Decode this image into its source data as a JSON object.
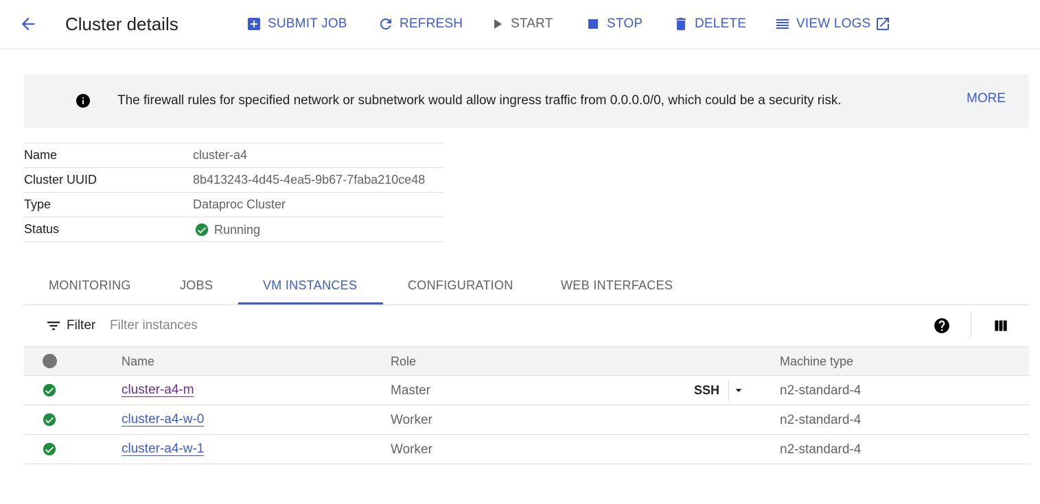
{
  "header": {
    "title": "Cluster details",
    "toolbar": {
      "submit_job": "SUBMIT JOB",
      "refresh": "REFRESH",
      "start": "START",
      "stop": "STOP",
      "delete": "DELETE",
      "view_logs": "VIEW LOGS"
    }
  },
  "banner": {
    "icon": "info-icon",
    "message": "The firewall rules for specified network or subnetwork would allow ingress traffic from 0.0.0.0/0, which could be a security risk.",
    "action": "MORE"
  },
  "details": [
    {
      "label": "Name",
      "value": "cluster-a4"
    },
    {
      "label": "Cluster UUID",
      "value": "8b413243-4d45-4ea5-9b67-7faba210ce48"
    },
    {
      "label": "Type",
      "value": "Dataproc Cluster"
    },
    {
      "label": "Status",
      "value": "Running",
      "status_icon": "check-circle-icon"
    }
  ],
  "tabs": [
    {
      "label": "MONITORING"
    },
    {
      "label": "JOBS"
    },
    {
      "label": "VM INSTANCES",
      "active": true
    },
    {
      "label": "CONFIGURATION"
    },
    {
      "label": "WEB INTERFACES"
    }
  ],
  "filter": {
    "label": "Filter",
    "placeholder": "Filter instances",
    "value": ""
  },
  "instances": {
    "columns": {
      "name": "Name",
      "role": "Role",
      "machine_type": "Machine type"
    },
    "rows": [
      {
        "name": "cluster-a4-m",
        "role": "Master",
        "machine_type": "n2-standard-4",
        "ssh": "SSH"
      },
      {
        "name": "cluster-a4-w-0",
        "role": "Worker",
        "machine_type": "n2-standard-4"
      },
      {
        "name": "cluster-a4-w-1",
        "role": "Worker",
        "machine_type": "n2-standard-4"
      }
    ]
  },
  "colors": {
    "accent": "#3b5bd6",
    "success": "#1e8e3e",
    "visited_link": "#6b2e8c",
    "banner_bg": "#f1f3f4"
  }
}
